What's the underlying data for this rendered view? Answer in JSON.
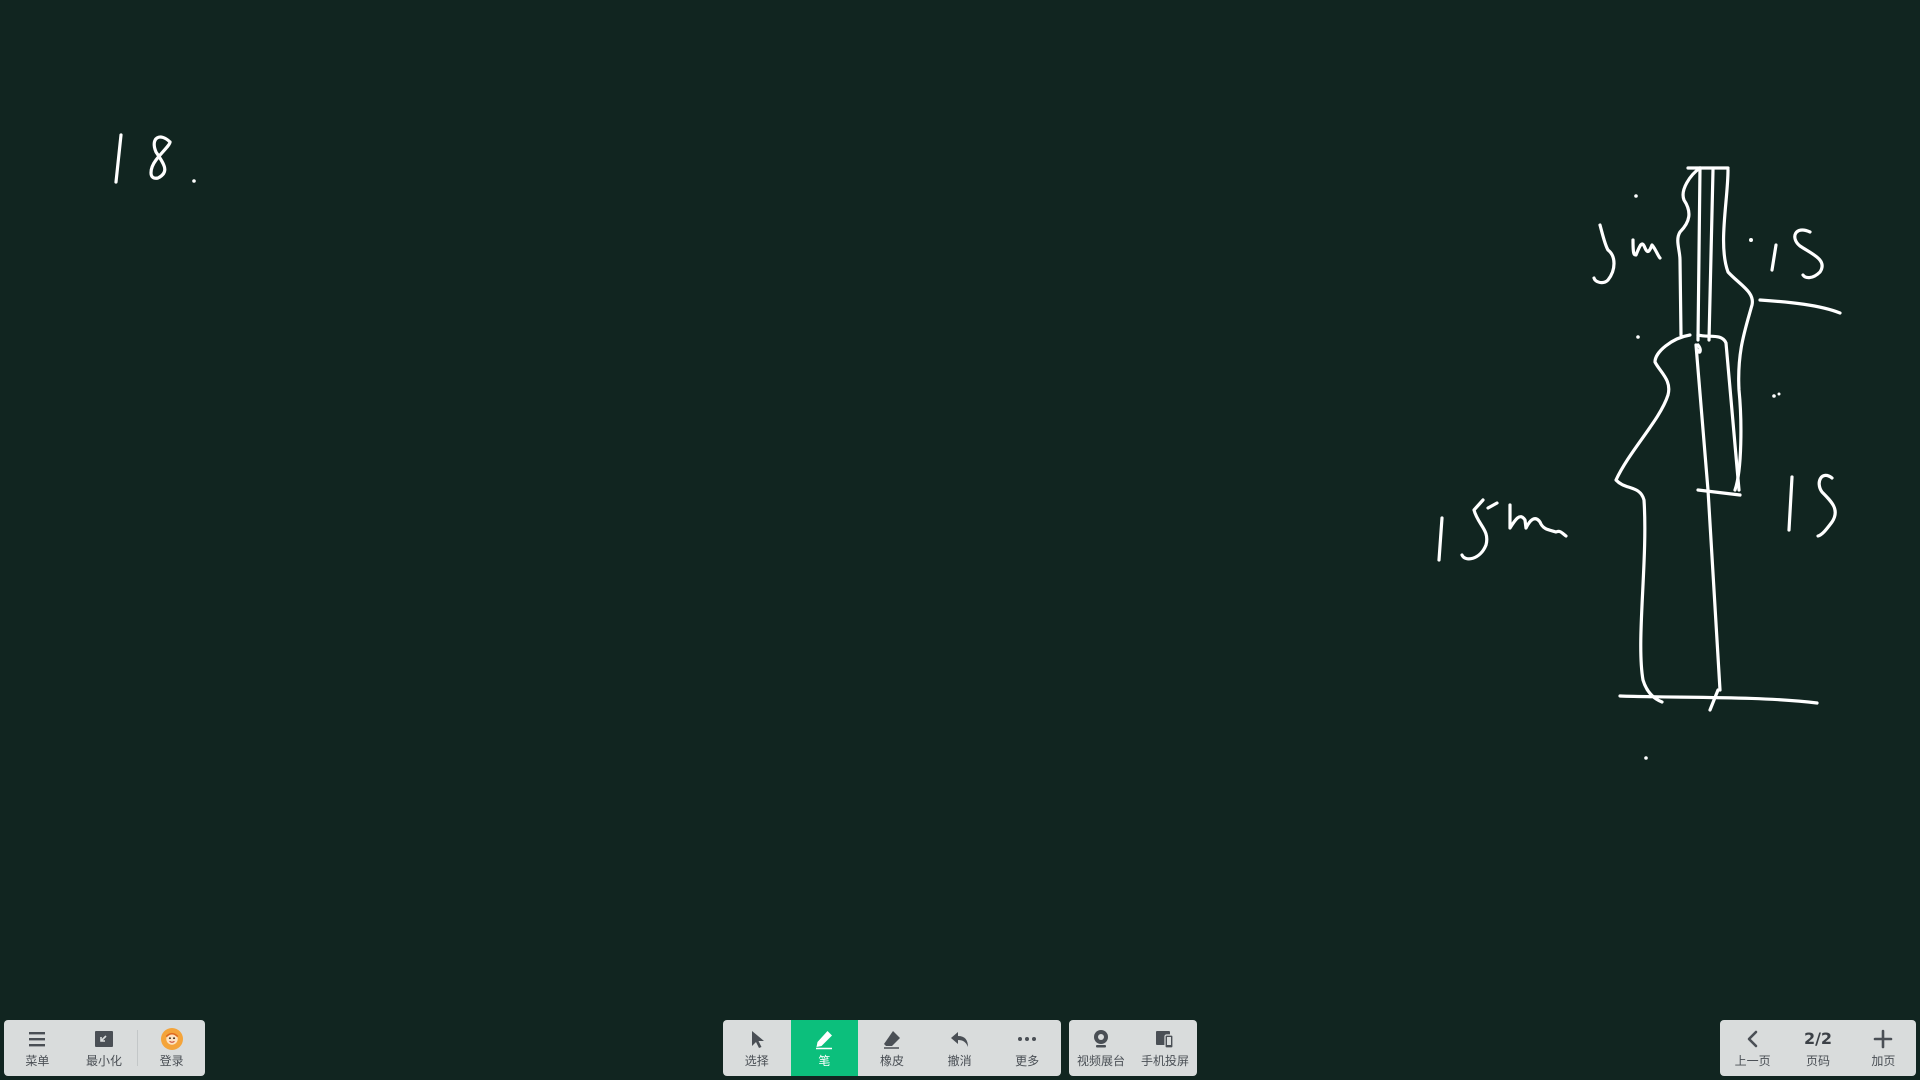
{
  "board": {
    "background": "#112520",
    "ink_color": "#ffffff",
    "handwriting": "18. sketch: 5m · 1s · 15m · 1s"
  },
  "toolbar_left": {
    "items": [
      {
        "label": "菜单",
        "icon": "menu-icon"
      },
      {
        "label": "最小化",
        "icon": "minimize-icon"
      },
      {
        "label": "登录",
        "icon": "avatar-icon"
      }
    ]
  },
  "toolbar_center": {
    "items": [
      {
        "label": "选择",
        "icon": "cursor-icon"
      },
      {
        "label": "笔",
        "icon": "pen-icon",
        "active": true
      },
      {
        "label": "橡皮",
        "icon": "eraser-icon"
      },
      {
        "label": "撤消",
        "icon": "undo-icon"
      },
      {
        "label": "更多",
        "icon": "more-icon"
      }
    ],
    "accent": "#0cbf7c"
  },
  "toolbar_center2": {
    "items": [
      {
        "label": "视频展台",
        "icon": "camera-icon"
      },
      {
        "label": "手机投屏",
        "icon": "phone-cast-icon"
      }
    ]
  },
  "toolbar_right": {
    "prev_label": "上一页",
    "page_value": "2/2",
    "page_label": "页码",
    "add_label": "加页"
  }
}
